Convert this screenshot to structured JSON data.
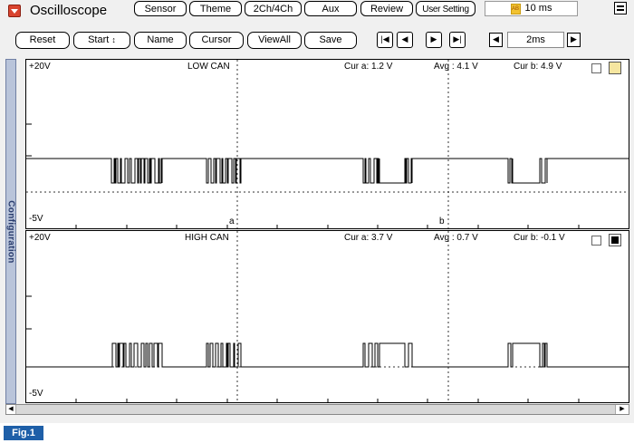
{
  "app": {
    "title": "Oscilloscope",
    "menu_icon": "dropdown-menu-icon",
    "window_menu_icon": "window-menu-icon"
  },
  "top_buttons": [
    "Sensor",
    "Theme",
    "2Ch/4Ch",
    "Aux",
    "Review",
    "User Setting"
  ],
  "time_display": {
    "icon": "timer-icon",
    "value": "10 ms"
  },
  "toolbar": {
    "reset": "Reset",
    "start": "Start",
    "start_arrows": "↕",
    "name": "Name",
    "cursor": "Cursor",
    "view_all": "ViewAll",
    "save": "Save"
  },
  "navigation": {
    "first": "|◀",
    "prev": "◀",
    "next": "▶",
    "last": "▶|"
  },
  "time_div": {
    "dec": "◀",
    "value": "2ms",
    "inc": "▶"
  },
  "config_tab": "Configuration",
  "channels": [
    {
      "title": "LOW CAN",
      "y_max": "+20V",
      "y_min": "-5V",
      "cur_a": "Cur a: 1.2 V",
      "avg": "Avg : 4.1 V",
      "cur_b": "Cur b: 4.9 V",
      "cursor_a_label": "a",
      "cursor_b_label": "b",
      "trace_color": "#000000",
      "swatch_color": "#f6e6a0"
    },
    {
      "title": "HIGH CAN",
      "y_max": "+20V",
      "y_min": "-5V",
      "cur_a": "Cur a: 3.7 V",
      "avg": "Avg : 0.7 V",
      "cur_b": "Cur b: -0.1 V",
      "trace_color": "#000000",
      "swatch_color": "#000000"
    }
  ],
  "scrollbar": {
    "left": "◀",
    "right": "▶"
  },
  "figure_label": "Fig.1"
}
